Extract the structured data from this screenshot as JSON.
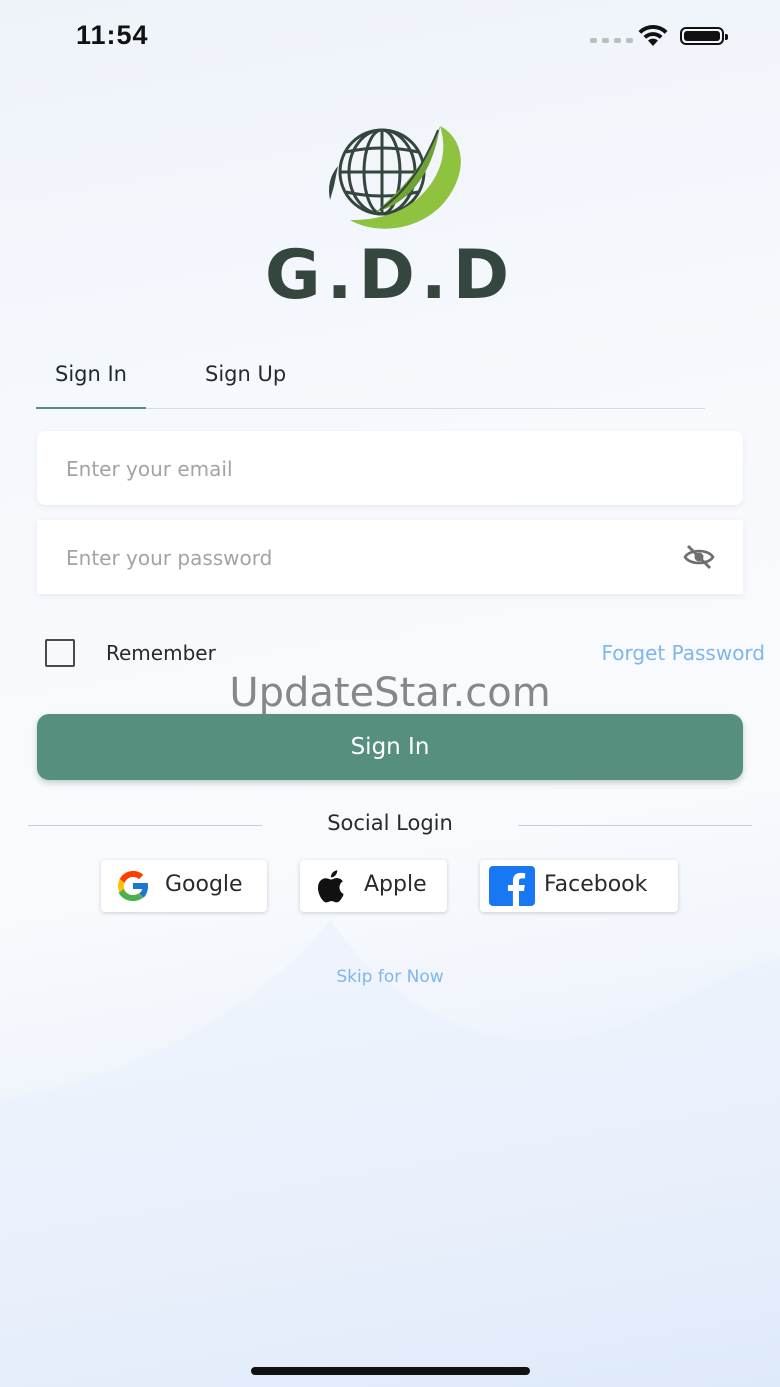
{
  "status_bar": {
    "time": "11:54",
    "icons": [
      "signal-dots-icon",
      "wifi-icon",
      "battery-icon"
    ]
  },
  "brand": {
    "name": "G.D.D",
    "logo": "globe-leaf-logo",
    "colors": {
      "dark": "#35463f",
      "leaf": "#7fb23a"
    }
  },
  "tabs": [
    {
      "label": "Sign In",
      "active": true
    },
    {
      "label": "Sign Up",
      "active": false
    }
  ],
  "form": {
    "email": {
      "value": "",
      "placeholder": "Enter your email"
    },
    "password": {
      "value": "",
      "placeholder": "Enter your password",
      "toggle_icon": "eye-off-icon"
    },
    "remember": {
      "label": "Remember",
      "checked": false
    },
    "forgot_label": "Forget Password",
    "submit_label": "Sign In"
  },
  "watermark": "UpdateStar.com",
  "social": {
    "title": "Social Login",
    "buttons": [
      {
        "label": "Google",
        "icon": "google-icon"
      },
      {
        "label": "Apple",
        "icon": "apple-icon"
      },
      {
        "label": "Facebook",
        "icon": "facebook-icon"
      }
    ]
  },
  "skip_label": "Skip for Now",
  "colors": {
    "primary": "#568f7e",
    "link": "#7fb6ec",
    "facebook": "#1877f2"
  }
}
